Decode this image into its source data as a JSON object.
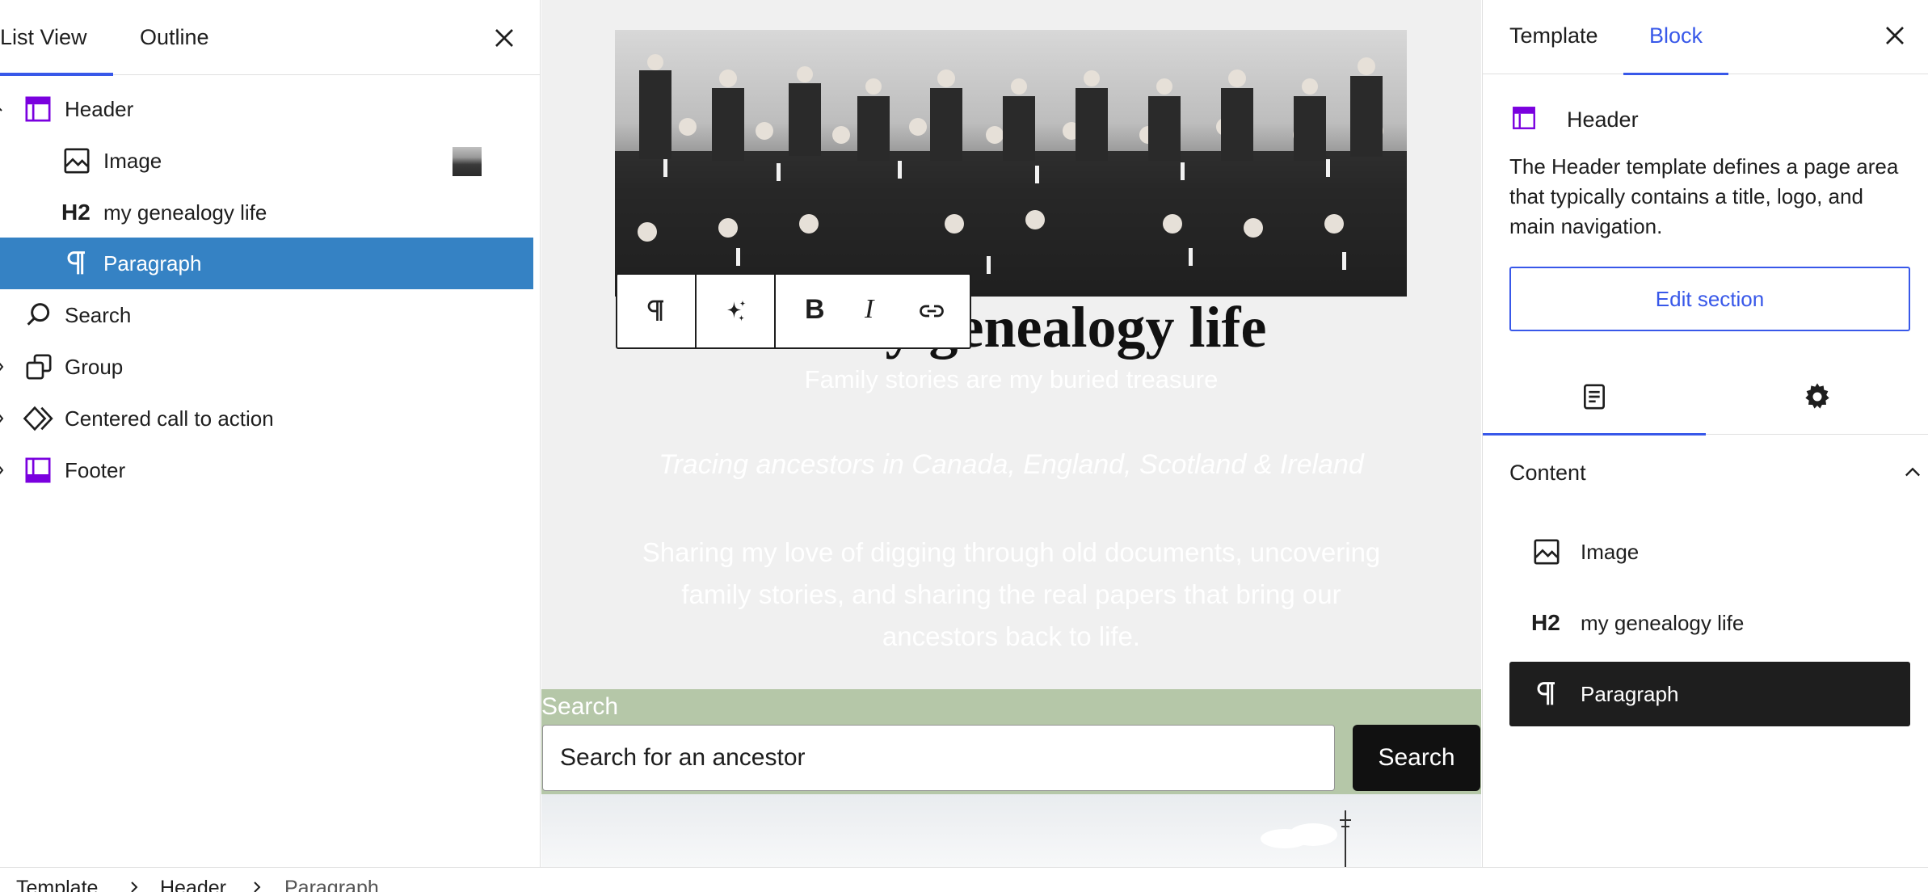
{
  "left_panel": {
    "tabs": [
      {
        "label": "List View"
      },
      {
        "label": "Outline"
      }
    ],
    "items": [
      {
        "label": "Header",
        "icon": "template-part-header-icon"
      },
      {
        "label": "Image",
        "icon": "image-icon"
      },
      {
        "label": "my genealogy life",
        "icon": "heading-h2-icon",
        "icon_text": "H2"
      },
      {
        "label": "Paragraph",
        "icon": "paragraph-icon"
      },
      {
        "label": "Search",
        "icon": "search-icon"
      },
      {
        "label": "Group",
        "icon": "group-icon"
      },
      {
        "label": "Centered call to action",
        "icon": "pattern-icon"
      },
      {
        "label": "Footer",
        "icon": "template-part-footer-icon"
      }
    ]
  },
  "canvas": {
    "site_title_partial": "y genealogy life",
    "tagline": "Family stories are my buried treasure",
    "italic_line": "Tracing ancestors in Canada, England, Scotland & Ireland",
    "description": "Sharing my love of digging through old documents, uncovering family stories, and sharing the real papers that bring our ancestors back to life.",
    "search": {
      "label": "Search",
      "placeholder": "Search for an ancestor",
      "button_label": "Search"
    },
    "toolbar": [
      "paragraph-icon",
      "sparkle-icon",
      "bold-icon",
      "italic-icon",
      "link-icon"
    ],
    "toolbar_bold_glyph": "B",
    "toolbar_italic_glyph": "I"
  },
  "right_panel": {
    "tabs": [
      {
        "label": "Template"
      },
      {
        "label": "Block"
      }
    ],
    "block": {
      "title": "Header",
      "description": "The Header template defines a page area that typically contains a title, logo, and main navigation.",
      "edit_button": "Edit section"
    },
    "content": {
      "heading": "Content",
      "items": [
        {
          "label": "Image",
          "icon": "image-icon"
        },
        {
          "label": "my genealogy life",
          "icon": "heading-h2-icon",
          "icon_text": "H2"
        },
        {
          "label": "Paragraph",
          "icon": "paragraph-icon"
        }
      ]
    }
  },
  "breadcrumb": [
    "Template",
    "Header",
    "Paragraph"
  ],
  "colors": {
    "accent": "#3858e9",
    "list_selected": "#3582c4",
    "template_part_icon": "#7a00df",
    "search_band": "#b5c7a8"
  }
}
